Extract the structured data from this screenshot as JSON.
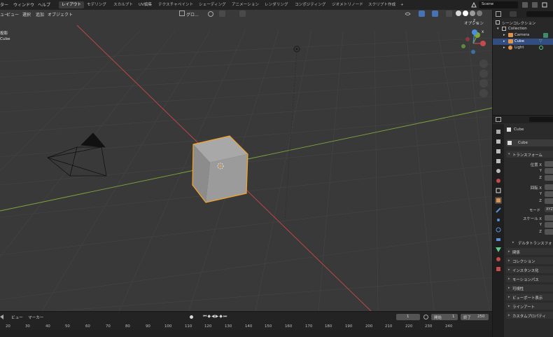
{
  "topbar": {
    "menus": [
      "ター",
      "ウィンドウ",
      "ヘルプ"
    ],
    "workspaces": [
      "レイアウト",
      "モデリング",
      "スカルプト",
      "UV編集",
      "テクスチャペイント",
      "シェーディング",
      "アニメーション",
      "レンダリング",
      "コンポジティング",
      "ジオメトリノード",
      "スクリプト作成"
    ],
    "add_tab": "+",
    "scene": "Scene"
  },
  "viewport": {
    "menus": [
      "ュー",
      "ビュー",
      "選択",
      "追加",
      "オブジェクト"
    ],
    "transform_orientation": "グロ...",
    "options_label": "オプション",
    "info_line1": "投影",
    "info_line2": "Cube",
    "gizmo": {
      "x": "X",
      "y": "Y",
      "z": "Z"
    }
  },
  "outliner": {
    "root": "シーンコレクション",
    "collection": "Collection",
    "items": [
      "Camera",
      "Cube",
      "Light"
    ]
  },
  "properties": {
    "object_name": "Cube",
    "mesh_name": "Cube",
    "transform_header": "トランスフォーム",
    "location_label": "位置 X",
    "rotation_label": "回転 X",
    "scale_label": "スケール X",
    "axis_y": "Y",
    "axis_z": "Z",
    "mode_label": "モード",
    "mode_value": "XYZ",
    "delta_transform": "デルタトランスフォ",
    "sections": [
      "関係",
      "コレクション",
      "インスタンス化",
      "モーションパス",
      "可視性",
      "ビューポート表示",
      "ラインアート",
      "カスタムプロパティ"
    ]
  },
  "timeline": {
    "menus": [
      "ビュー",
      "マーカー"
    ],
    "current_frame": "1",
    "start_label": "開始",
    "start_value": "1",
    "end_label": "終了",
    "end_value": "250",
    "ticks": [
      "20",
      "30",
      "40",
      "50",
      "60",
      "70",
      "80",
      "90",
      "100",
      "110",
      "120",
      "130",
      "140",
      "150",
      "160",
      "170",
      "180",
      "190",
      "200",
      "210",
      "220",
      "230",
      "240"
    ]
  },
  "colors": {
    "accent": "#4772b3",
    "selection_outline": "#f5a623",
    "x_axis": "#c8494c",
    "y_axis": "#7fa83d",
    "z_axis": "#4a8fd9"
  }
}
